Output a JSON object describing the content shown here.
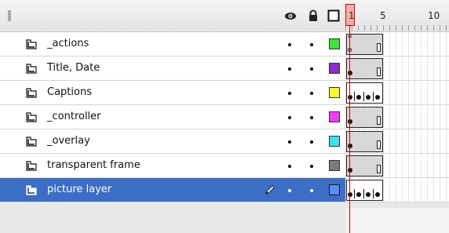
{
  "header": {
    "frame_numbers": [
      "1",
      "5",
      "10"
    ],
    "icons": {
      "eye": "eye-icon",
      "lock": "lock-icon",
      "outline": "outline-icon"
    }
  },
  "layers": [
    {
      "name": "_actions",
      "color": "#39e639",
      "type": "action",
      "selected": false
    },
    {
      "name": "Title, Date",
      "color": "#8b2fc9",
      "type": "span",
      "selected": false
    },
    {
      "name": "Captions",
      "color": "#f7f732",
      "type": "keyframes",
      "selected": false
    },
    {
      "name": "_controller",
      "color": "#f23ef2",
      "type": "span",
      "selected": false
    },
    {
      "name": "_overlay",
      "color": "#40e0f0",
      "type": "span",
      "selected": false
    },
    {
      "name": "transparent frame",
      "color": "#7a7a7a",
      "type": "span",
      "selected": false
    },
    {
      "name": "picture layer",
      "color": "#5a8cff",
      "type": "keyframes",
      "selected": true
    }
  ],
  "colors": {
    "selection": "#3d6ec5",
    "playhead": "#d40000"
  }
}
